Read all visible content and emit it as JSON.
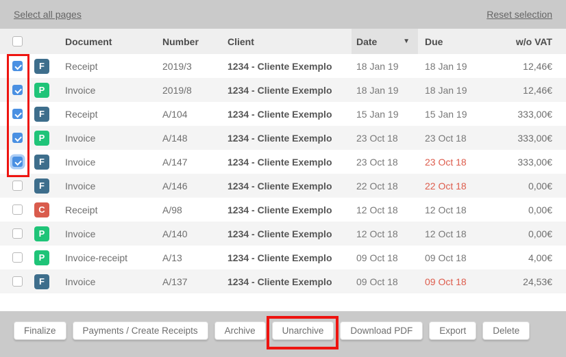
{
  "toolbar": {
    "select_all_label": "Select all pages",
    "reset_label": "Reset selection"
  },
  "table": {
    "columns": {
      "document": "Document",
      "number": "Number",
      "client": "Client",
      "date": "Date",
      "due": "Due",
      "vat": "w/o VAT"
    },
    "sorted_column": "Date",
    "sort_indicator": "▼",
    "badge_colors": {
      "F": "#3e6e8c",
      "P": "#1fc478",
      "C": "#d95c4d"
    },
    "rows": [
      {
        "checked": true,
        "focused": false,
        "badge": "F",
        "document": "Receipt",
        "number": "2019/3",
        "client": "1234 - Cliente Exemplo",
        "date": "18 Jan 19",
        "due": "18 Jan 19",
        "due_overdue": false,
        "vat": "12,46€"
      },
      {
        "checked": true,
        "focused": false,
        "badge": "P",
        "document": "Invoice",
        "number": "2019/8",
        "client": "1234 - Cliente Exemplo",
        "date": "18 Jan 19",
        "due": "18 Jan 19",
        "due_overdue": false,
        "vat": "12,46€"
      },
      {
        "checked": true,
        "focused": false,
        "badge": "F",
        "document": "Receipt",
        "number": "A/104",
        "client": "1234 - Cliente Exemplo",
        "date": "15 Jan 19",
        "due": "15 Jan 19",
        "due_overdue": false,
        "vat": "333,00€"
      },
      {
        "checked": true,
        "focused": false,
        "badge": "P",
        "document": "Invoice",
        "number": "A/148",
        "client": "1234 - Cliente Exemplo",
        "date": "23 Oct 18",
        "due": "23 Oct 18",
        "due_overdue": false,
        "vat": "333,00€"
      },
      {
        "checked": true,
        "focused": true,
        "badge": "F",
        "document": "Invoice",
        "number": "A/147",
        "client": "1234 - Cliente Exemplo",
        "date": "23 Oct 18",
        "due": "23 Oct 18",
        "due_overdue": true,
        "vat": "333,00€"
      },
      {
        "checked": false,
        "focused": false,
        "badge": "F",
        "document": "Invoice",
        "number": "A/146",
        "client": "1234 - Cliente Exemplo",
        "date": "22 Oct 18",
        "due": "22 Oct 18",
        "due_overdue": true,
        "vat": "0,00€"
      },
      {
        "checked": false,
        "focused": false,
        "badge": "C",
        "document": "Receipt",
        "number": "A/98",
        "client": "1234 - Cliente Exemplo",
        "date": "12 Oct 18",
        "due": "12 Oct 18",
        "due_overdue": false,
        "vat": "0,00€"
      },
      {
        "checked": false,
        "focused": false,
        "badge": "P",
        "document": "Invoice",
        "number": "A/140",
        "client": "1234 - Cliente Exemplo",
        "date": "12 Oct 18",
        "due": "12 Oct 18",
        "due_overdue": false,
        "vat": "0,00€"
      },
      {
        "checked": false,
        "focused": false,
        "badge": "P",
        "document": "Invoice-receipt",
        "number": "A/13",
        "client": "1234 - Cliente Exemplo",
        "date": "09 Oct 18",
        "due": "09 Oct 18",
        "due_overdue": false,
        "vat": "4,00€"
      },
      {
        "checked": false,
        "focused": false,
        "badge": "F",
        "document": "Invoice",
        "number": "A/137",
        "client": "1234 - Cliente Exemplo",
        "date": "09 Oct 18",
        "due": "09 Oct 18",
        "due_overdue": true,
        "vat": "24,53€"
      }
    ]
  },
  "footer": {
    "buttons": [
      "Finalize",
      "Payments / Create Receipts",
      "Archive",
      "Unarchive",
      "Download PDF",
      "Export",
      "Delete"
    ],
    "highlighted_button": "Unarchive"
  },
  "annotation_color": "#ee1410"
}
